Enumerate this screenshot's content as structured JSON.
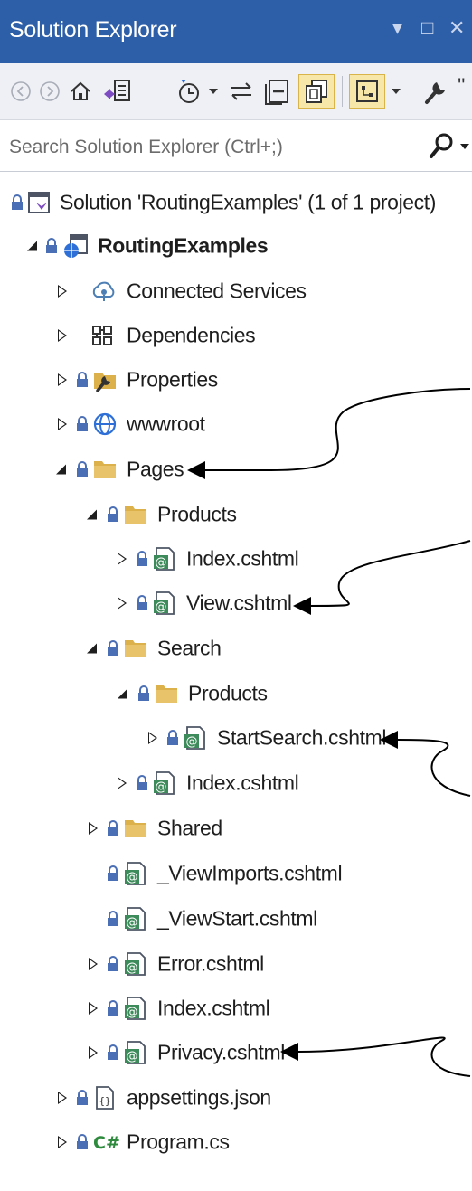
{
  "window": {
    "title": "Solution Explorer",
    "controls": [
      "pin-dropdown",
      "maximize",
      "close"
    ]
  },
  "toolbar": {
    "buttons": [
      "back-icon",
      "forward-icon",
      "home-icon",
      "switch-views-icon",
      "pending-changes-filter-icon",
      "sync-icon",
      "collapse-all-icon",
      "show-all-files-icon",
      "preview-icon",
      "properties-icon"
    ],
    "overflow": "''"
  },
  "search": {
    "placeholder": "Search Solution Explorer (Ctrl+;)"
  },
  "tree": {
    "solution": "Solution 'RoutingExamples' (1 of 1 project)",
    "project": "RoutingExamples",
    "items": [
      {
        "label": "Connected Services",
        "icon": "connected-services-icon"
      },
      {
        "label": "Dependencies",
        "icon": "dependencies-icon"
      },
      {
        "label": "Properties",
        "icon": "properties-folder-icon"
      },
      {
        "label": "wwwroot",
        "icon": "globe-icon"
      },
      {
        "label": "Pages",
        "icon": "folder-icon"
      },
      {
        "label": "Products",
        "icon": "folder-icon"
      },
      {
        "label": "Index.cshtml",
        "icon": "razor-file-icon"
      },
      {
        "label": "View.cshtml",
        "icon": "razor-file-icon"
      },
      {
        "label": "Search",
        "icon": "folder-icon"
      },
      {
        "label": "Products",
        "icon": "folder-icon"
      },
      {
        "label": "StartSearch.cshtml",
        "icon": "razor-file-icon"
      },
      {
        "label": "Index.cshtml",
        "icon": "razor-file-icon"
      },
      {
        "label": "Shared",
        "icon": "folder-icon"
      },
      {
        "label": "_ViewImports.cshtml",
        "icon": "razor-file-icon"
      },
      {
        "label": "_ViewStart.cshtml",
        "icon": "razor-file-icon"
      },
      {
        "label": "Error.cshtml",
        "icon": "razor-file-icon"
      },
      {
        "label": "Index.cshtml",
        "icon": "razor-file-icon"
      },
      {
        "label": "Privacy.cshtml",
        "icon": "razor-file-icon"
      },
      {
        "label": "appsettings.json",
        "icon": "json-file-icon"
      },
      {
        "label": "Program.cs",
        "icon": "csharp-file-icon"
      }
    ]
  },
  "colors": {
    "titlebar": "#2d5ea8",
    "toolbar": "#eef0f5",
    "folder": "#dcb04a",
    "razor": "#3d8b5a",
    "lock": "#4b6fb5",
    "annotation_arrow": "#000000"
  }
}
